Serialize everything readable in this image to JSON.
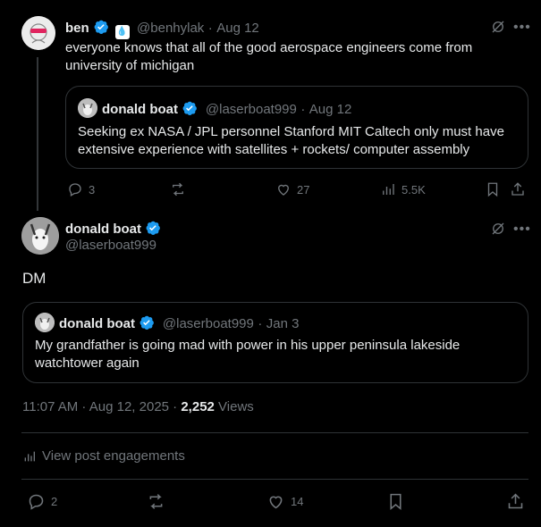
{
  "reply_tweet": {
    "author_name": "ben",
    "badge_emoji": "💧",
    "handle": "@benhylak",
    "separator": "·",
    "date": "Aug 12",
    "text": "everyone knows that all of the good aerospace engineers come from university of michigan",
    "quoted": {
      "author_name": "donald boat",
      "handle": "@laserboat999",
      "separator": "·",
      "date": "Aug 12",
      "text": "Seeking ex NASA / JPL personnel Stanford MIT Caltech only must have extensive experience with satellites + rockets/ computer assembly"
    },
    "actions": {
      "replies": "3",
      "reposts": "",
      "likes": "27",
      "views": "5.5K"
    }
  },
  "main_tweet": {
    "author_name": "donald boat",
    "handle": "@laserboat999",
    "text": "DM",
    "quoted": {
      "author_name": "donald boat",
      "handle": "@laserboat999",
      "separator": "·",
      "date": "Jan 3",
      "text": "My grandfather is going mad with power in his  upper peninsula lakeside watchtower again"
    },
    "timestamp": "11:07 AM · Aug 12, 2025 · ",
    "views_count": "2,252",
    "views_label": " Views",
    "engagements_link": "View post engagements",
    "actions": {
      "replies": "2",
      "likes": "14"
    }
  },
  "colors": {
    "background": "#000000",
    "text": "#e7e9ea",
    "muted": "#71767b",
    "border": "#2f3336",
    "verified": "#1d9bf0"
  }
}
